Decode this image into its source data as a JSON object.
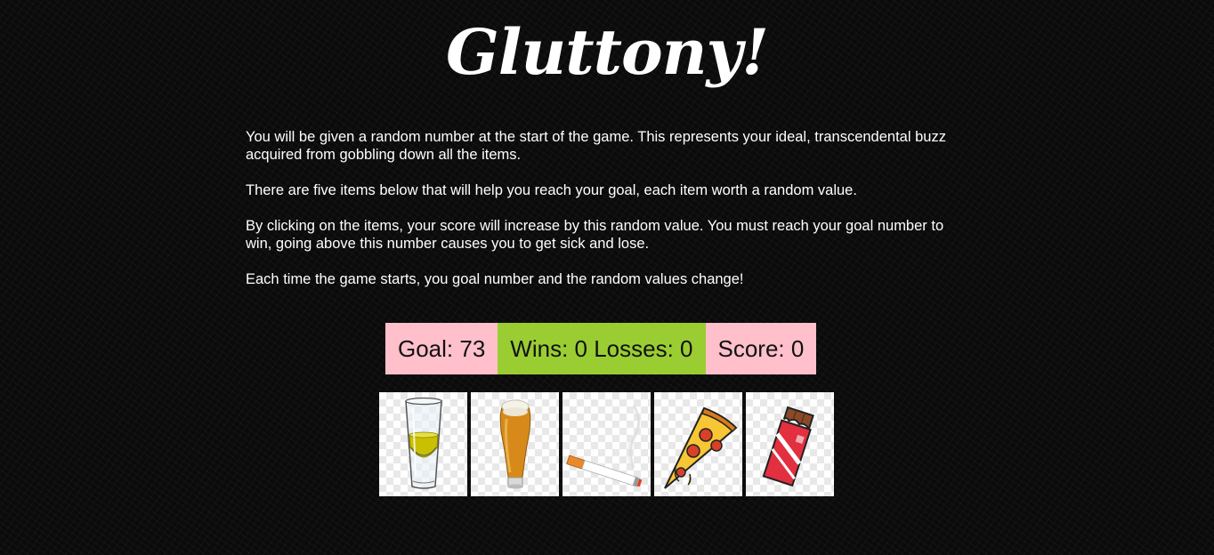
{
  "header": {
    "title": "Gluttony!"
  },
  "instructions": {
    "paragraphs": [
      "You will be given a random number at the start of the game. This represents your ideal, transcendental buzz acquired from gobbling down all the items.",
      "There are five items below that will help you reach your goal, each item worth a random value.",
      "By clicking on the items, your score will increase by this random value. You must reach your goal number to win, going above this number causes you to get sick and lose.",
      "Each time the game starts, you goal number and the random values change!"
    ]
  },
  "scoreboard": {
    "goal": "Goal: 73",
    "wins_losses": "Wins: 0 Losses: 0",
    "score": "Score: 0"
  },
  "items": [
    {
      "icon": "shot-glass-icon"
    },
    {
      "icon": "beer-glass-icon"
    },
    {
      "icon": "cigarette-icon"
    },
    {
      "icon": "pizza-slice-icon"
    },
    {
      "icon": "chocolate-bar-icon"
    }
  ],
  "colors": {
    "background": "#0b0b0b",
    "goal_box": "#ffc0cb",
    "wins_box": "#9acd32",
    "score_box": "#ffc0cb",
    "text": "#ffffff"
  }
}
